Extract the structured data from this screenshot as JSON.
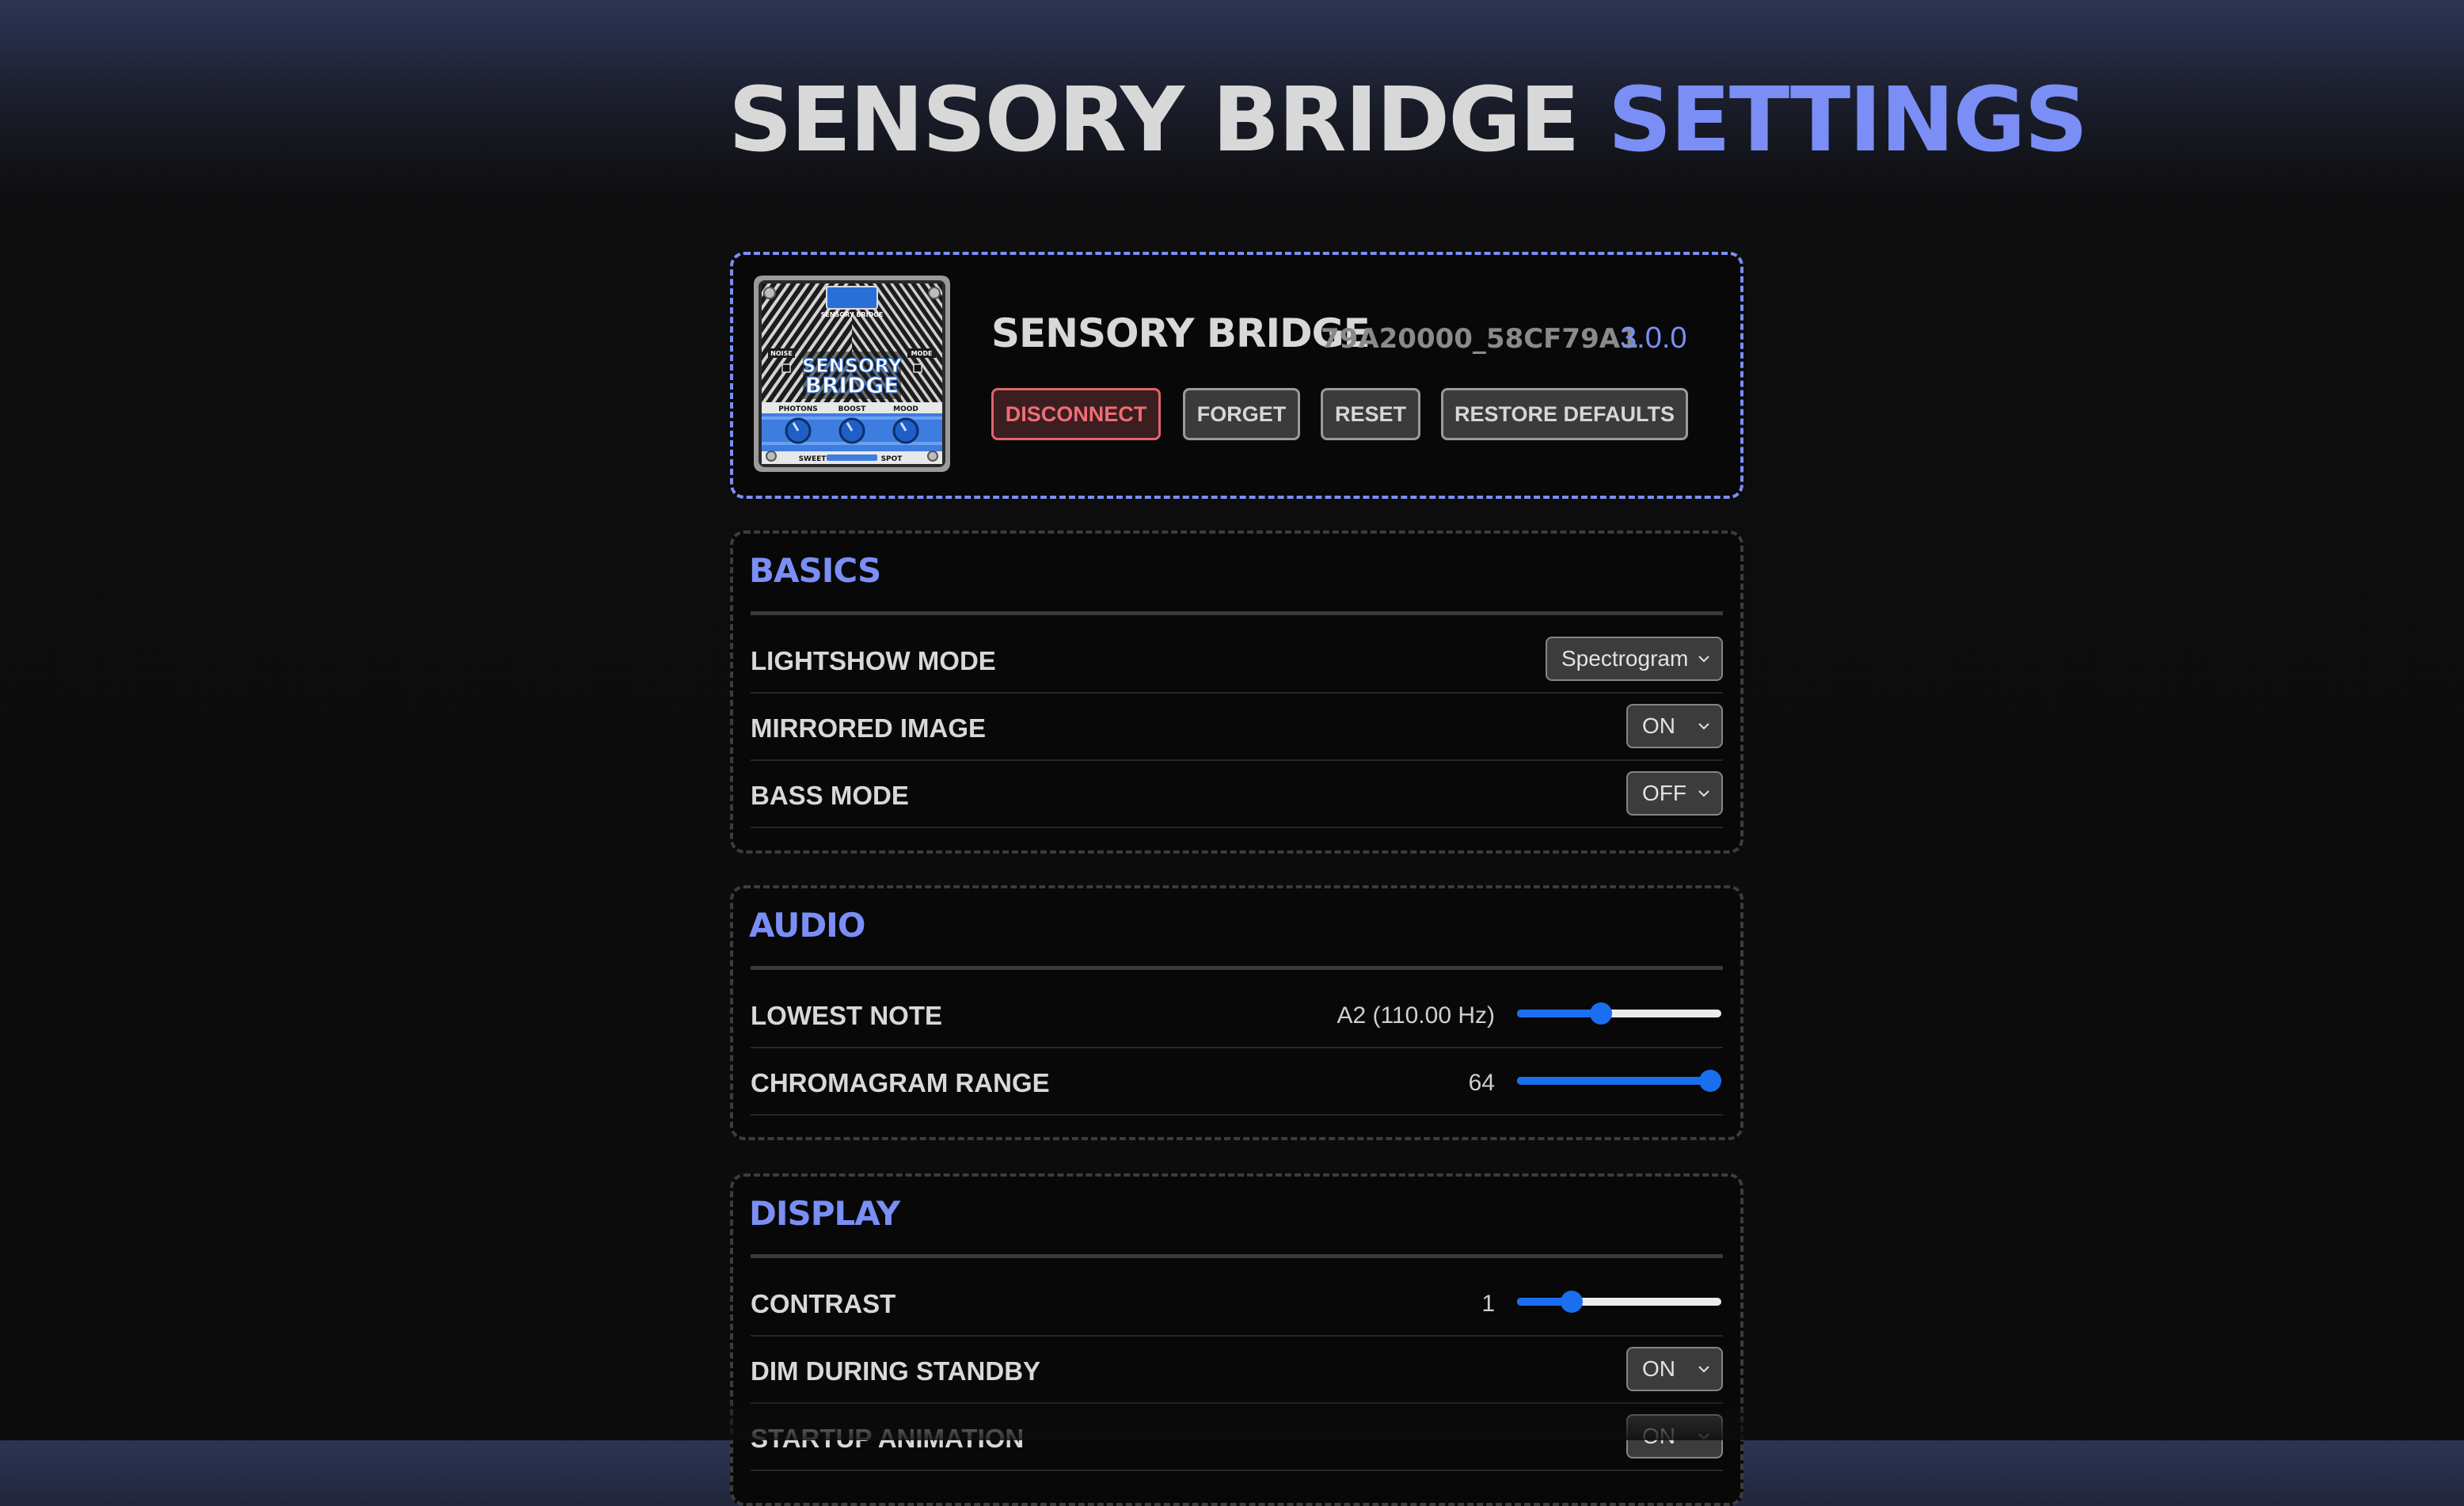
{
  "header": {
    "title_main": "SENSORY BRIDGE",
    "title_accent": "SETTINGS"
  },
  "device": {
    "name": "SENSORY BRIDGE",
    "id": "79A20000_58CF79A1",
    "version": "3.0.0",
    "image": {
      "top_label": "SENSORY BRIDGE",
      "left_label": "NOISE",
      "right_label": "MODE",
      "title_line1": "SENSORY",
      "title_line2": "BRIDGE",
      "knob_labels": [
        "PHOTONS",
        "BOOST",
        "MOOD"
      ],
      "bottom_left": "SWEET",
      "bottom_right": "SPOT"
    },
    "buttons": {
      "disconnect": "DISCONNECT",
      "forget": "FORGET",
      "reset": "RESET",
      "restore_defaults": "RESTORE DEFAULTS"
    }
  },
  "basics": {
    "title": "BASICS",
    "lightshow_mode": {
      "label": "LIGHTSHOW MODE",
      "value": "Spectrogram"
    },
    "mirrored_image": {
      "label": "MIRRORED IMAGE",
      "value": "ON"
    },
    "bass_mode": {
      "label": "BASS MODE",
      "value": "OFF"
    }
  },
  "audio": {
    "title": "AUDIO",
    "lowest_note": {
      "label": "LOWEST NOTE",
      "value_text": "A2 (110.00 Hz)",
      "fraction": 0.4
    },
    "chromagram_range": {
      "label": "CHROMAGRAM RANGE",
      "value_text": "64",
      "fraction": 1.0
    }
  },
  "display": {
    "title": "DISPLAY",
    "contrast": {
      "label": "CONTRAST",
      "value_text": "1",
      "fraction": 0.24
    },
    "dim_during_standby": {
      "label": "DIM DURING STANDBY",
      "value": "ON"
    },
    "startup_animation": {
      "label": "STARTUP ANIMATION",
      "value": "ON"
    }
  },
  "colors": {
    "accent": "#7a8ef5",
    "danger": "#ef6e74",
    "slider": "#1a6ff0"
  }
}
